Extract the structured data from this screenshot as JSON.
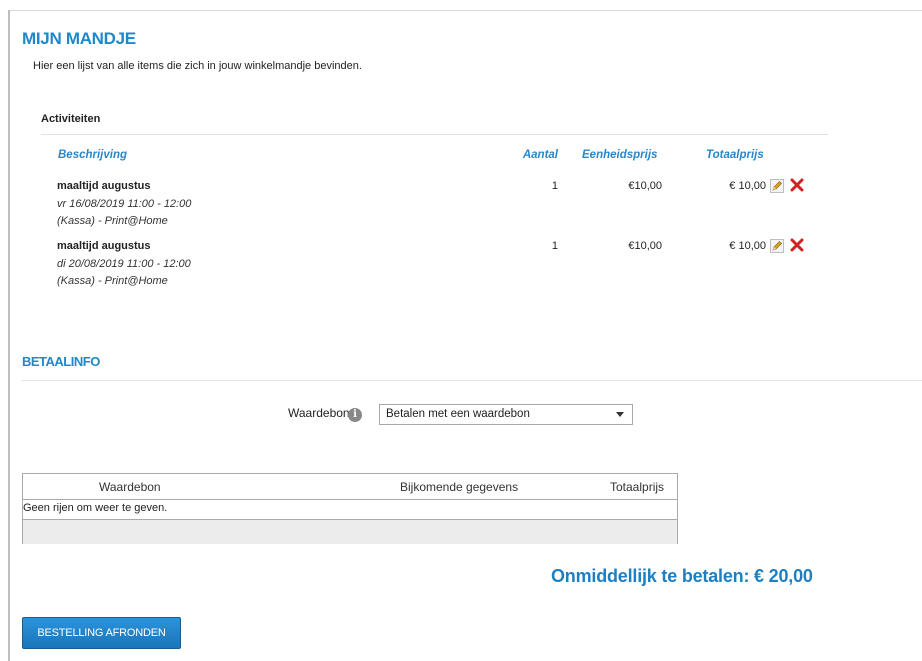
{
  "cart": {
    "title": "MIJN MANDJE",
    "intro": "Hier een lijst van alle items die zich in jouw winkelmandje bevinden.",
    "section_label": "Activiteiten",
    "columns": {
      "description": "Beschrijving",
      "quantity": "Aantal",
      "unit_price": "Eenheidsprijs",
      "total_price": "Totaalprijs"
    },
    "items": [
      {
        "name": "maaltijd augustus",
        "date": "vr 16/08/2019 11:00 - 12:00",
        "location": "(Kassa) - Print@Home",
        "quantity": "1",
        "unit_price": "€10,00",
        "total": "€ 10,00"
      },
      {
        "name": "maaltijd augustus",
        "date": "di 20/08/2019 11:00 - 12:00",
        "location": "(Kassa) - Print@Home",
        "quantity": "1",
        "unit_price": "€10,00",
        "total": "€ 10,00"
      }
    ]
  },
  "payment": {
    "title": "BETAALINFO",
    "voucher_label": "Waardebon",
    "voucher_select_value": "Betalen met een waardebon",
    "grid": {
      "columns": [
        "Waardebon",
        "Bijkomende gegevens",
        "Totaalprijs"
      ],
      "empty_text": "Geen rijen om weer te geven."
    },
    "pay_now": "Onmiddellijk te betalen: € 20,00",
    "finish_button": "BESTELLING AFRONDEN"
  },
  "colors": {
    "accent": "#1e88c8",
    "delete": "#d32020"
  },
  "icons": {
    "info": "info-icon",
    "edit": "edit-pencil-icon",
    "delete": "delete-x-icon",
    "dropdown": "chevron-down-icon"
  }
}
